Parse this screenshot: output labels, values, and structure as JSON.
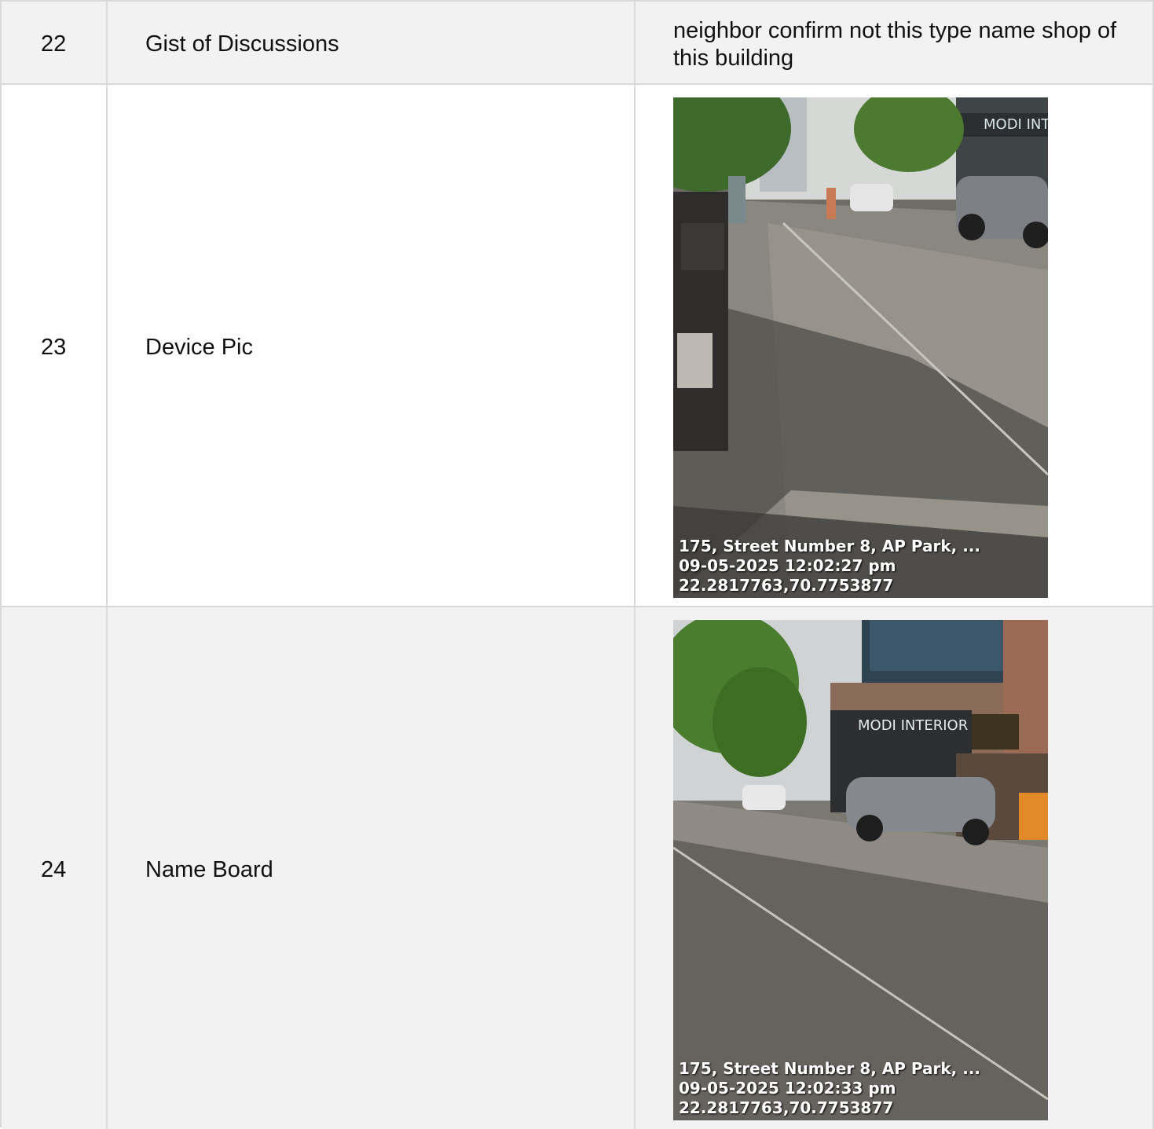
{
  "rows": [
    {
      "no": "22",
      "label": "Gist of Discussions",
      "value": "neighbor confirm not this type name shop of this building"
    },
    {
      "no": "23",
      "label": "Device Pic",
      "photo": {
        "address": "175, Street Number 8, AP Park, ...",
        "datetime": "09-05-2025 12:02:27 pm",
        "coords": "22.2817763,70.7753877",
        "sign": "MODI INTER"
      }
    },
    {
      "no": "24",
      "label": "Name Board",
      "photo": {
        "address": "175, Street Number 8, AP Park, ...",
        "datetime": "09-05-2025 12:02:33 pm",
        "coords": "22.2817763,70.7753877",
        "sign": "MODI INTERIOR"
      }
    }
  ]
}
